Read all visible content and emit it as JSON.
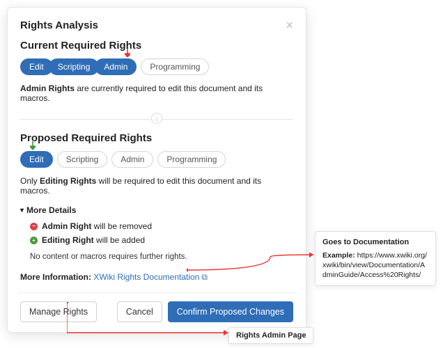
{
  "modal": {
    "title": "Rights Analysis",
    "close": "×"
  },
  "current": {
    "heading": "Current Required Rights",
    "pills": {
      "edit": "Edit",
      "scripting": "Scripting",
      "admin": "Admin",
      "programming": "Programming"
    },
    "desc_bold": "Admin Rights",
    "desc_rest": " are currently required to edit this document and its macros."
  },
  "divider": {
    "arrow": "↓"
  },
  "proposed": {
    "heading": "Proposed Required Rights",
    "pills": {
      "edit": "Edit",
      "scripting": "Scripting",
      "admin": "Admin",
      "programming": "Programming"
    },
    "desc_prefix": "Only ",
    "desc_bold": "Editing Rights",
    "desc_rest": " will be required to edit this document and its macros."
  },
  "details": {
    "toggle": "More Details",
    "triangle": "▾",
    "remove_bold": "Admin Right",
    "remove_rest": " will be removed",
    "add_bold": "Editing Right",
    "add_rest": " will be added",
    "no_content": "No content or macros requires further rights.",
    "dot_minus": "−",
    "dot_plus": "+"
  },
  "more_info": {
    "label": "More Information: ",
    "link_text": "XWiki Rights Documentation",
    "ext_glyph": "⧉"
  },
  "footer": {
    "manage": "Manage Rights",
    "cancel": "Cancel",
    "confirm": "Confirm Proposed Changes"
  },
  "callout1": {
    "title": "Goes to Documentation",
    "example_label": "Example: ",
    "example_url": "https://www.xwiki.org/xwiki/bin/view/Documentation/AdminGuide/Access%20Rights/"
  },
  "callout2": {
    "text": "Rights Admin Page"
  }
}
